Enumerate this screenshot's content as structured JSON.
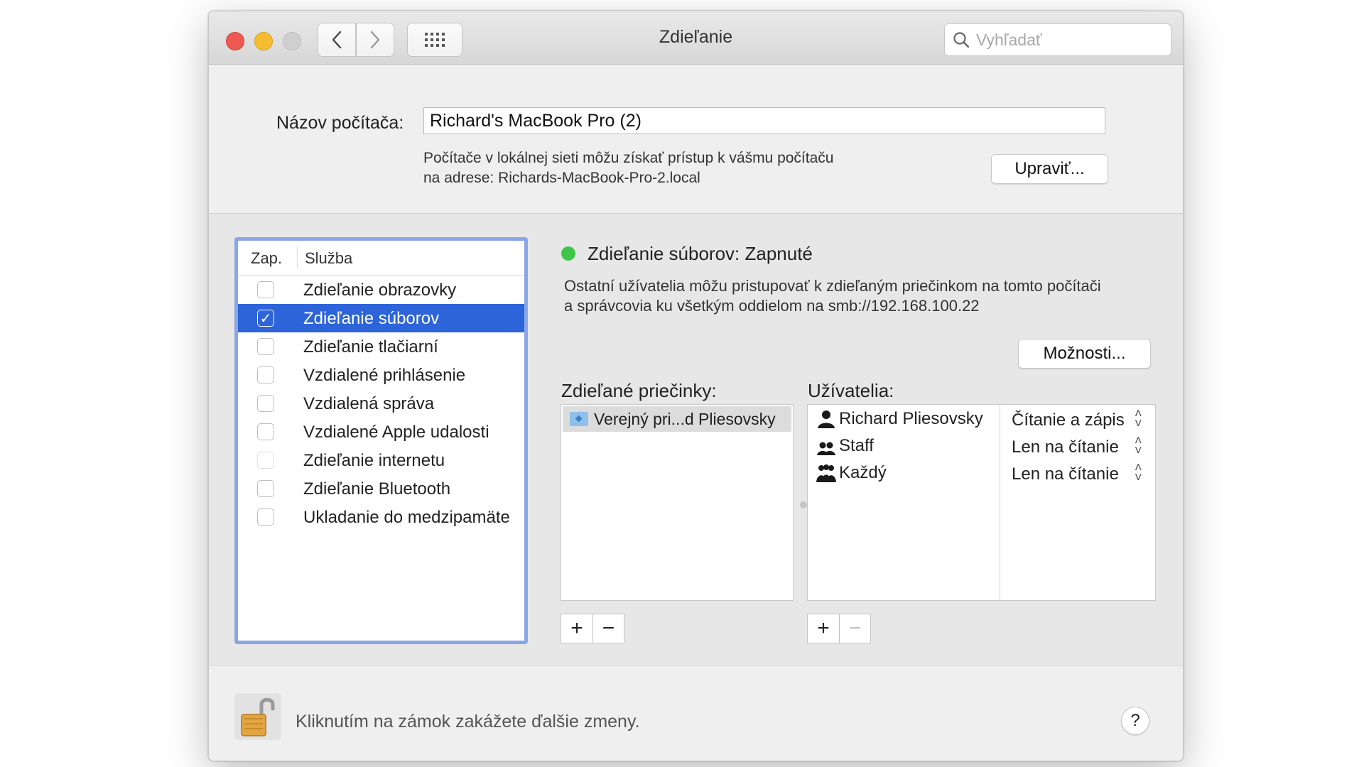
{
  "window": {
    "title": "Zdieľanie",
    "search_placeholder": "Vyhľadať"
  },
  "computer": {
    "name_label": "Názov počítača:",
    "name_value": "Richard's MacBook Pro (2)",
    "address_line1": "Počítače v lokálnej sieti môžu získať prístup k vášmu počítaču",
    "address_line2": "na adrese: Richards-MacBook-Pro-2.local",
    "edit_button": "Upraviť..."
  },
  "services": {
    "col_on": "Zap.",
    "col_service": "Služba",
    "items": [
      {
        "label": "Zdieľanie obrazovky",
        "checked": false
      },
      {
        "label": "Zdieľanie súborov",
        "checked": true
      },
      {
        "label": "Zdieľanie tlačiarní",
        "checked": false
      },
      {
        "label": "Vzdialené prihlásenie",
        "checked": false
      },
      {
        "label": "Vzdialená správa",
        "checked": false
      },
      {
        "label": "Vzdialené Apple udalosti",
        "checked": false
      },
      {
        "label": "Zdieľanie internetu",
        "checked": false
      },
      {
        "label": "Zdieľanie Bluetooth",
        "checked": false
      },
      {
        "label": "Ukladanie do medzipamäte",
        "checked": false
      }
    ],
    "selected_index": 1
  },
  "detail": {
    "status": "Zdieľanie súborov: Zapnuté",
    "status_color": "#3ec54a",
    "desc_line1": "Ostatní užívatelia môžu pristupovať k zdieľaným priečinkom na tomto počítači",
    "desc_line2": "a správcovia ku všetkým oddielom na smb://192.168.100.22",
    "options_button": "Možnosti...",
    "folders_label": "Zdieľané priečinky:",
    "users_label": "Užívatelia:",
    "folders": [
      {
        "name": "Verejný pri...d Pliesovsky",
        "icon": "folder-icon"
      }
    ],
    "users": [
      {
        "name": "Richard Pliesovsky",
        "permission": "Čítanie a zápis",
        "icon": "user-icon"
      },
      {
        "name": "Staff",
        "permission": "Len na čítanie",
        "icon": "group-icon"
      },
      {
        "name": "Každý",
        "permission": "Len na čítanie",
        "icon": "everyone-icon"
      }
    ],
    "add_symbol": "+",
    "remove_symbol": "−"
  },
  "footer": {
    "lock_text": "Kliknutím na zámok zakážete ďalšie zmeny.",
    "help": "?"
  },
  "colors": {
    "selection": "#2d64d9",
    "list_focus": "#8aa6e6"
  }
}
